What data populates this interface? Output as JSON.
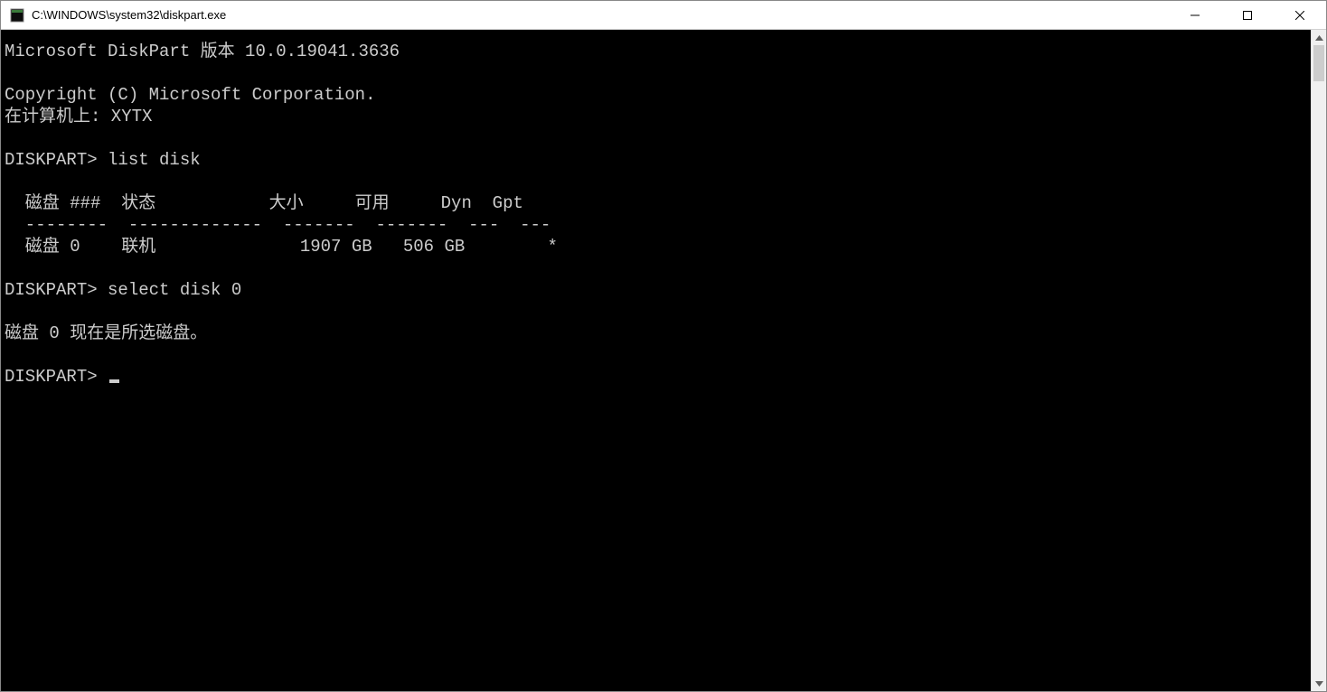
{
  "window": {
    "title": "C:\\WINDOWS\\system32\\diskpart.exe"
  },
  "terminal": {
    "lines": [
      "Microsoft DiskPart 版本 10.0.19041.3636",
      "",
      "Copyright (C) Microsoft Corporation.",
      "在计算机上: XYTX",
      "",
      "DISKPART> list disk",
      "",
      "  磁盘 ###  状态           大小     可用     Dyn  Gpt",
      "  --------  -------------  -------  -------  ---  ---",
      "  磁盘 0    联机              1907 GB   506 GB        *",
      "",
      "DISKPART> select disk 0",
      "",
      "磁盘 0 现在是所选磁盘。",
      "",
      "DISKPART> "
    ]
  }
}
